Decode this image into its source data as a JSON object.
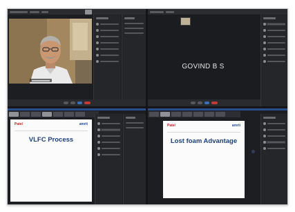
{
  "participant": {
    "name": "GOVIND B S"
  },
  "slides": {
    "left": {
      "logo_left": "Patel",
      "logo_left_sub": "",
      "logo_right": "amrit",
      "logo_right_sub": "",
      "title": "VLFC Process",
      "subheading": "",
      "bullets": []
    },
    "right": {
      "logo_left": "Patel",
      "logo_left_sub": "",
      "logo_right": "amrit",
      "logo_right_sub": "",
      "title": "Lost foam Advantage",
      "bullets": []
    }
  },
  "colors": {
    "app_background": "#1d1e21",
    "slide_title": "#1b3f7a",
    "leave_button": "#c23a36"
  },
  "icons": [
    "camera-icon",
    "mic-icon",
    "share-screen-icon",
    "leave-call-icon",
    "participant-icon"
  ]
}
